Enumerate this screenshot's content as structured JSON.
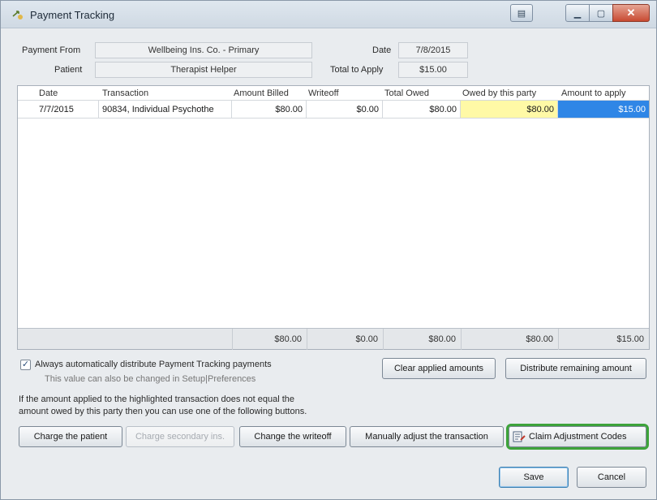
{
  "window": {
    "title": "Payment Tracking",
    "close_glyph": "✕",
    "min_glyph": "▁",
    "max_glyph": "▢",
    "extra_glyph": "▤"
  },
  "header": {
    "payment_from_label": "Payment From",
    "payment_from_value": "Wellbeing Ins. Co. - Primary",
    "patient_label": "Patient",
    "patient_value": "Therapist Helper",
    "date_label": "Date",
    "date_value": "7/8/2015",
    "total_label": "Total to Apply",
    "total_value": "$15.00"
  },
  "grid": {
    "columns": [
      "Date",
      "Transaction",
      "Amount Billed",
      "Writeoff",
      "Total Owed",
      "Owed by this party",
      "Amount to apply"
    ],
    "rows": [
      [
        "7/7/2015",
        "90834, Individual Psychothe",
        "$80.00",
        "$0.00",
        "$80.00",
        "$80.00",
        "$15.00"
      ]
    ],
    "totals": [
      "$80.00",
      "$0.00",
      "$80.00",
      "$80.00",
      "$15.00"
    ],
    "colors": {
      "owed_highlight": "#fff9a6",
      "selected": "#2f86e6"
    }
  },
  "options": {
    "auto_distribute_label": "Always automatically distribute Payment Tracking payments",
    "auto_distribute_checked": true,
    "auto_distribute_hint": "This value can also be changed in Setup|Preferences",
    "check_glyph": "✓"
  },
  "buttons": {
    "clear": "Clear applied amounts",
    "distribute": "Distribute remaining amount",
    "charge_patient": "Charge the patient",
    "charge_secondary": "Charge secondary ins.",
    "change_writeoff": "Change the writeoff",
    "manual_adjust": "Manually adjust the transaction",
    "claim_codes": "Claim Adjustment Codes",
    "save": "Save",
    "cancel": "Cancel"
  },
  "instructions": {
    "line1": "If the amount applied to the highlighted transaction does not equal the",
    "line2": "amount owed by this party then you can use one of the following buttons."
  },
  "icons": {
    "app": "payment-arrow-icon",
    "claim": "claim-codes-icon"
  },
  "accent": {
    "highlight_border": "#3da33a"
  }
}
